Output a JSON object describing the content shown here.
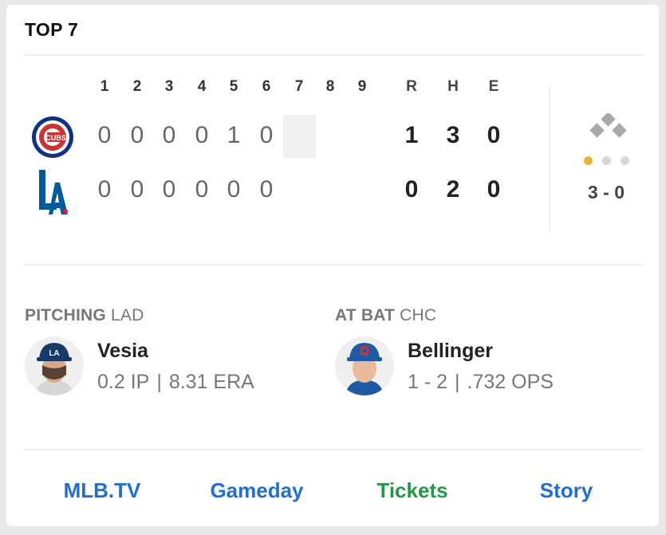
{
  "header": {
    "inning": "TOP 7"
  },
  "linescore": {
    "innings": [
      "1",
      "2",
      "3",
      "4",
      "5",
      "6",
      "7",
      "8",
      "9"
    ],
    "rhe_headers": [
      "R",
      "H",
      "E"
    ],
    "away": {
      "innings": [
        "0",
        "0",
        "0",
        "0",
        "1",
        "0"
      ],
      "runs": "1",
      "hits": "3",
      "errors": "0"
    },
    "home": {
      "innings": [
        "0",
        "0",
        "0",
        "0",
        "0",
        "0"
      ],
      "runs": "0",
      "hits": "2",
      "errors": "0"
    }
  },
  "situation": {
    "outs": 1,
    "count": "3 - 0"
  },
  "pitching": {
    "label": "PITCHING",
    "team": "LAD",
    "name": "Vesia",
    "stat1": "0.2 IP",
    "stat2": "8.31 ERA"
  },
  "at_bat": {
    "label": "AT BAT",
    "team": "CHC",
    "name": "Bellinger",
    "stat1": "1 - 2",
    "stat2": ".732 OPS"
  },
  "links": [
    "MLB.TV",
    "Gameday",
    "Tickets",
    "Story"
  ],
  "colors": {
    "link_blue": "#1f6fd1",
    "tickets_green": "#1f9a45",
    "out_on": "#e8b634",
    "cubs_blue": "#0e3386",
    "cubs_red": "#cc3433",
    "dodgers_blue": "#005a9c"
  },
  "icons": {
    "away_logo": "cubs-logo",
    "home_logo": "dodgers-logo"
  }
}
